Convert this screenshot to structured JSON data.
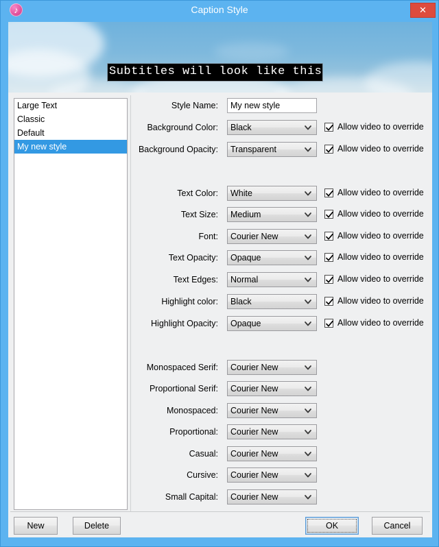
{
  "window": {
    "title": "Caption Style",
    "app_icon": "itunes-music-note-icon",
    "close_label": "✕",
    "accent_color": "#5cb3f0",
    "close_color": "#dd4b3e"
  },
  "preview": {
    "caption_text": "Subtitles will look like this",
    "caption_bg": "#000000",
    "caption_fg": "#ffffff"
  },
  "styles_list": {
    "items": [
      {
        "label": "Large Text",
        "selected": false
      },
      {
        "label": "Classic",
        "selected": false
      },
      {
        "label": "Default",
        "selected": false
      },
      {
        "label": "My new style",
        "selected": true
      }
    ],
    "selection_color": "#3399e3"
  },
  "override_label": "Allow video to override",
  "checkmark": "✔",
  "form": {
    "style_name": {
      "label": "Style Name:",
      "value": "My new style",
      "placeholder": "Style Name"
    },
    "group_background": [
      {
        "label": "Background Color:",
        "value": "Black",
        "override": true
      },
      {
        "label": "Background Opacity:",
        "value": "Transparent",
        "override": true
      }
    ],
    "group_text": [
      {
        "label": "Text Color:",
        "value": "White",
        "override": true
      },
      {
        "label": "Text Size:",
        "value": "Medium",
        "override": true
      },
      {
        "label": "Font:",
        "value": "Courier New",
        "override": true
      },
      {
        "label": "Text Opacity:",
        "value": "Opaque",
        "override": true
      },
      {
        "label": "Text Edges:",
        "value": "Normal",
        "override": true
      },
      {
        "label": "Highlight color:",
        "value": "Black",
        "override": true
      },
      {
        "label": "Highlight Opacity:",
        "value": "Opaque",
        "override": true
      }
    ],
    "group_fonts": [
      {
        "label": "Monospaced Serif:",
        "value": "Courier New"
      },
      {
        "label": "Proportional Serif:",
        "value": "Courier New"
      },
      {
        "label": "Monospaced:",
        "value": "Courier New"
      },
      {
        "label": "Proportional:",
        "value": "Courier New"
      },
      {
        "label": "Casual:",
        "value": "Courier New"
      },
      {
        "label": "Cursive:",
        "value": "Courier New"
      },
      {
        "label": "Small Capital:",
        "value": "Courier New"
      }
    ]
  },
  "footer": {
    "new_label": "New",
    "delete_label": "Delete",
    "ok_label": "OK",
    "cancel_label": "Cancel"
  }
}
